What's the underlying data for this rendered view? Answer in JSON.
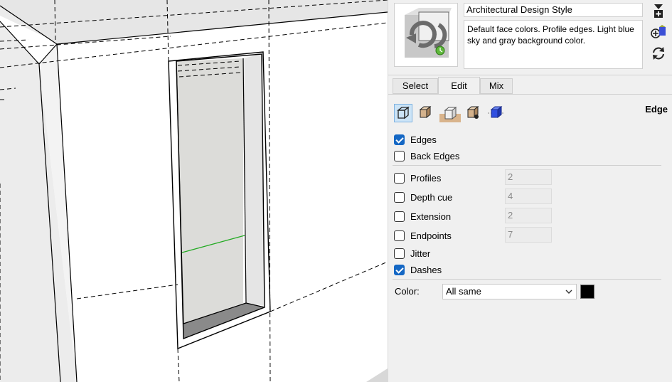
{
  "style": {
    "name": "Architectural Design Style",
    "description": "Default face colors. Profile edges. Light blue sky and gray background color."
  },
  "side_icons": [
    "create-new-style-icon",
    "add-style-icon",
    "update-style-icon"
  ],
  "tabs": [
    {
      "label": "Select",
      "active": false
    },
    {
      "label": "Edit",
      "active": true
    },
    {
      "label": "Mix",
      "active": false
    }
  ],
  "edit_toolbar": {
    "icons": [
      "edge-settings-icon",
      "face-settings-icon",
      "background-settings-icon",
      "watermark-settings-icon",
      "modeling-settings-icon"
    ],
    "section_title": "Edge"
  },
  "edge_settings": {
    "edges": {
      "label": "Edges",
      "checked": true
    },
    "back_edges": {
      "label": "Back Edges",
      "checked": false
    },
    "profiles": {
      "label": "Profiles",
      "checked": false,
      "value": "2"
    },
    "depth_cue": {
      "label": "Depth cue",
      "checked": false,
      "value": "4"
    },
    "extension": {
      "label": "Extension",
      "checked": false,
      "value": "2"
    },
    "endpoints": {
      "label": "Endpoints",
      "checked": false,
      "value": "7"
    },
    "jitter": {
      "label": "Jitter",
      "checked": false
    },
    "dashes": {
      "label": "Dashes",
      "checked": true
    }
  },
  "color": {
    "label": "Color:",
    "selected": "All same",
    "swatch": "#000000"
  }
}
